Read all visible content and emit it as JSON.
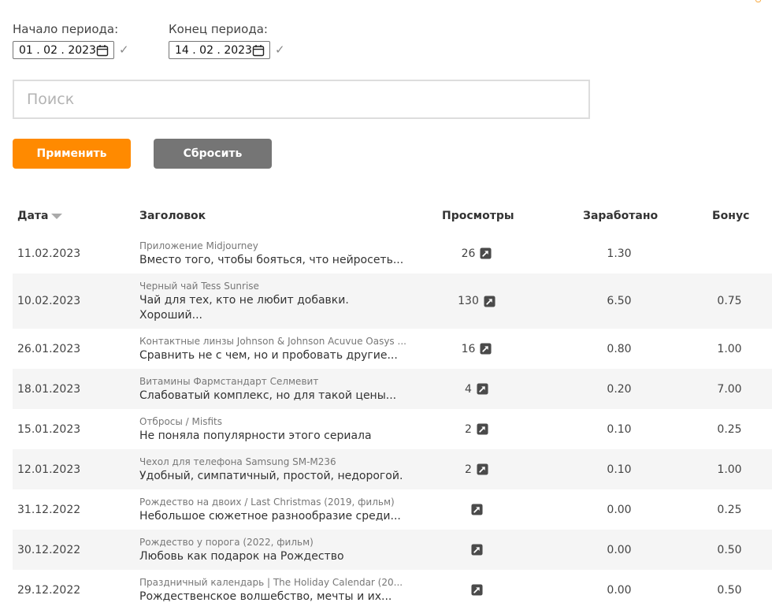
{
  "filters": {
    "start_label": "Начало периода:",
    "start_value": "01 . 02 . 2023",
    "end_label": "Конец периода:",
    "end_value": "14 . 02 . 2023",
    "check_glyph": "✓",
    "calendar_icon": "calendar-icon"
  },
  "search": {
    "placeholder": "Поиск",
    "value": ""
  },
  "buttons": {
    "apply_label": "Применить",
    "reset_label": "Сбросить"
  },
  "colors": {
    "accent": "#ff8a00",
    "secondary_button": "#757575",
    "row_stripe": "#f5f5f5"
  },
  "table": {
    "headers": {
      "date": "Дата",
      "title": "Заголовок",
      "views": "Просмотры",
      "earned": "Заработано",
      "bonus": "Бонус"
    },
    "sort": {
      "column": "date",
      "direction": "desc"
    },
    "rows": [
      {
        "date": "11.02.2023",
        "subtitle": "Приложение Midjourney",
        "title": "Вместо того, чтобы бояться, что нейросеть...",
        "views": "26",
        "earned": "1.30",
        "bonus": ""
      },
      {
        "date": "10.02.2023",
        "subtitle": "Черный чай Tess Sunrise",
        "title": "Чай для тех, кто не любит добавки. Хороший...",
        "views": "130",
        "earned": "6.50",
        "bonus": "0.75"
      },
      {
        "date": "26.01.2023",
        "subtitle": "Контактные линзы Johnson & Johnson Acuvue Oasys ...",
        "title": "Сравнить не с чем, но и пробовать другие...",
        "views": "16",
        "earned": "0.80",
        "bonus": "1.00"
      },
      {
        "date": "18.01.2023",
        "subtitle": "Витамины Фармстандарт Селмевит",
        "title": "Слабоватый комплекс, но для такой цены...",
        "views": "4",
        "earned": "0.20",
        "bonus": "7.00"
      },
      {
        "date": "15.01.2023",
        "subtitle": "Отбросы / Misfits",
        "title": "Не поняла популярности этого сериала",
        "views": "2",
        "earned": "0.10",
        "bonus": "0.25"
      },
      {
        "date": "12.01.2023",
        "subtitle": "Чехол для телефона Samsung SM-M236",
        "title": "Удобный, симпатичный, простой, недорогой.",
        "views": "2",
        "earned": "0.10",
        "bonus": "1.00"
      },
      {
        "date": "31.12.2022",
        "subtitle": "Рождество на двоих / Last Christmas (2019, фильм)",
        "title": "Небольшое сюжетное разнообразие среди...",
        "views": "",
        "earned": "0.00",
        "bonus": "0.25"
      },
      {
        "date": "30.12.2022",
        "subtitle": "Рождество у порога (2022, фильм)",
        "title": "Любовь как подарок на Рождество",
        "views": "",
        "earned": "0.00",
        "bonus": "0.50"
      },
      {
        "date": "29.12.2022",
        "subtitle": "Праздничный календарь | The Holiday Calendar (20...",
        "title": "Рождественское волшебство, мечты и их...",
        "views": "",
        "earned": "0.00",
        "bonus": "0.50"
      }
    ]
  }
}
